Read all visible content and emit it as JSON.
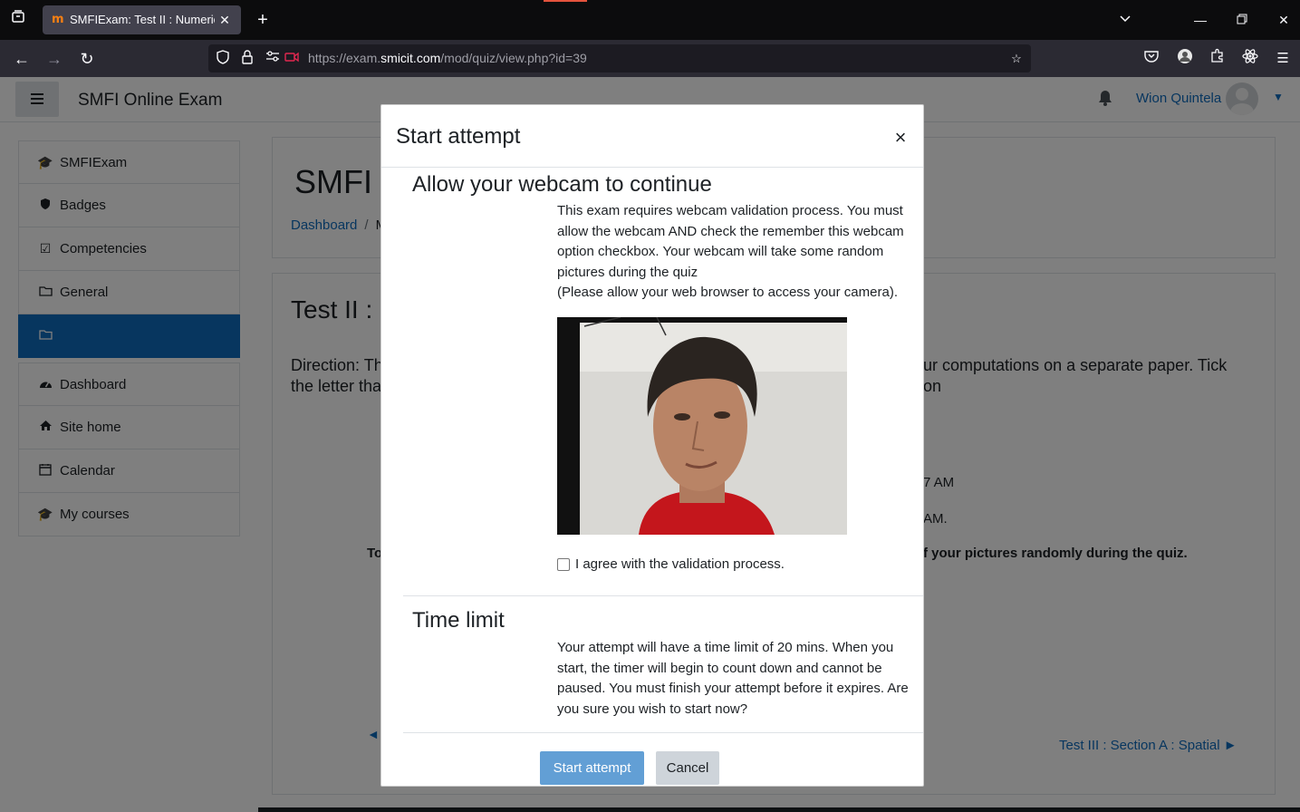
{
  "browser": {
    "tab_title": "SMFIExam: Test II : Numerical",
    "url_prefix": "https://exam.",
    "url_domain": "smicit.com",
    "url_path": "/mod/quiz/view.php?id=39"
  },
  "header": {
    "site_name": "SMFI Online Exam",
    "user_name": "Wion Quintela"
  },
  "drawer": {
    "items": [
      {
        "label": "SMFIExam",
        "icon": "graduation-cap-icon"
      },
      {
        "label": "Badges",
        "icon": "shield-icon"
      },
      {
        "label": "Competencies",
        "icon": "checkbox-icon"
      },
      {
        "label": "General",
        "icon": "folder-icon"
      },
      {
        "label": "",
        "icon": "folder-icon"
      },
      {
        "label": "Dashboard",
        "icon": "dashboard-icon"
      },
      {
        "label": "Site home",
        "icon": "home-icon"
      },
      {
        "label": "Calendar",
        "icon": "calendar-icon"
      },
      {
        "label": "My courses",
        "icon": "graduation-cap-icon"
      }
    ]
  },
  "main": {
    "course_title": "SMFI S",
    "breadcrumb_dashboard": "Dashboard",
    "breadcrumb_sep": "/",
    "breadcrumb_next": "M",
    "quiz_title": "Test II : N",
    "direction_left_1": "Direction: Th",
    "direction_left_2": "the letter tha",
    "direction_right": "ur computations on a separate paper. Tick on",
    "info_1": "7 AM",
    "info_2": "AM.",
    "bold_left": "To",
    "bold_right": "f your pictures randomly during the quiz.",
    "prev_link": "◄",
    "next_link": "Test III : Section A : Spatial ►"
  },
  "modal": {
    "title": "Start attempt",
    "close": "×",
    "webcam_heading": "Allow your webcam to continue",
    "webcam_text": "This exam requires webcam validation process. You must allow the webcam AND check the remember this webcam option checkbox. Your webcam will take some random pictures during the quiz",
    "webcam_note": "(Please allow your web browser to access your camera).",
    "agree_label": "I agree with the validation process.",
    "time_heading": "Time limit",
    "time_text": "Your attempt will have a time limit of 20 mins. When you start, the timer will begin to count down and cannot be paused. You must finish your attempt before it expires. Are you sure you wish to start now?",
    "start_button": "Start attempt",
    "cancel_button": "Cancel"
  },
  "colors": {
    "accent": "#0f6cbf",
    "backdrop": "#000000"
  }
}
